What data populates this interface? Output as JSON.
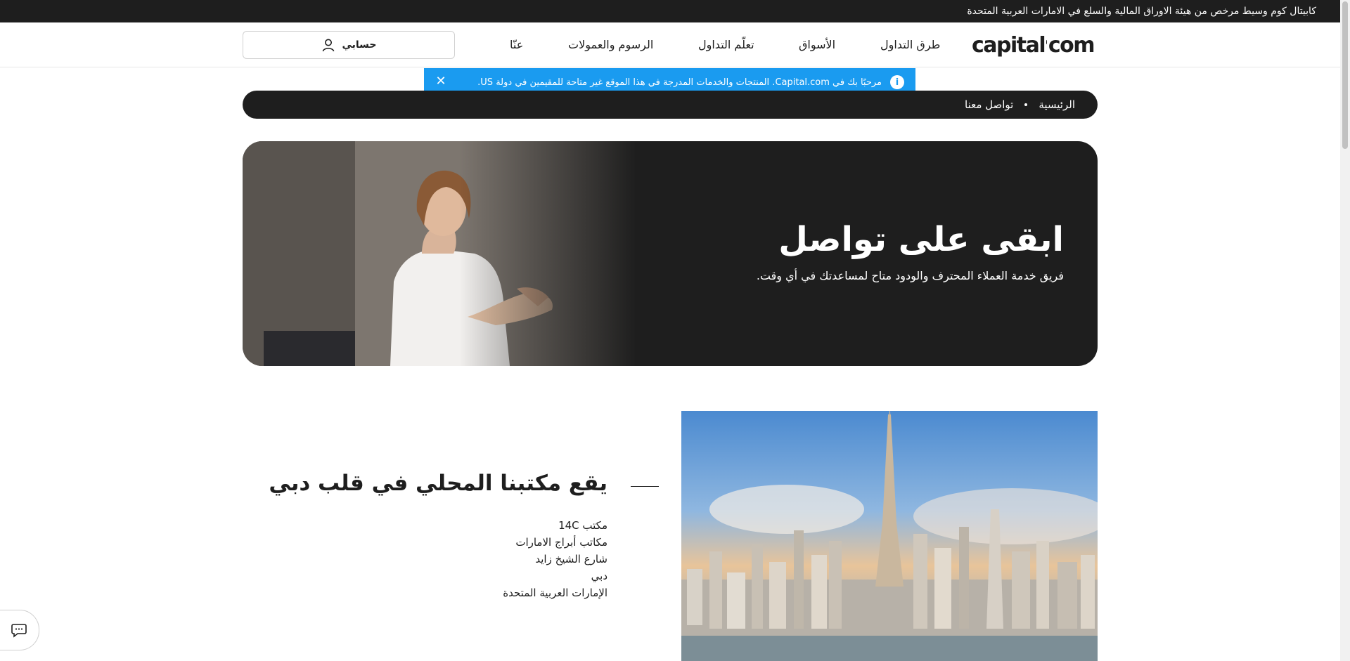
{
  "topbar": {
    "text": "كابيتال كوم وسيط مرخص من هيئة الاوراق المالية والسلع في الامارات العربية المتحدة"
  },
  "header": {
    "logo_left": "capital",
    "logo_right": "com",
    "nav": [
      {
        "label": "طرق التداول"
      },
      {
        "label": "الأسواق"
      },
      {
        "label": "تعلّم التداول"
      },
      {
        "label": "الرسوم والعمولات"
      },
      {
        "label": "عنّا"
      }
    ],
    "account_label": "حسابي"
  },
  "notice": {
    "text": "مرحبًا بك في Capital.com. المنتجات والخدمات المدرجة في هذا الموقع غير متاحة للمقيمين في دولة US.",
    "info_icon": "info-icon",
    "close_glyph": "✕"
  },
  "breadcrumb": {
    "home": "الرئيسية",
    "current": "تواصل معنا"
  },
  "hero": {
    "title": "ابقى على تواصل",
    "subtitle": "فريق خدمة العملاء المحترف والودود متاح لمساعدتك في أي وقت."
  },
  "office": {
    "title": "يقع مكتبنا المحلي في قلب دبي",
    "address_lines": [
      "مكتب 14C",
      "مكاتب أبراج الامارات",
      "شارع الشيخ زايد",
      "دبي",
      "الإمارات العربية المتحدة"
    ]
  },
  "colors": {
    "dark": "#1e1e1e",
    "notice_blue": "#1a9bf0",
    "white": "#ffffff"
  },
  "icons": {
    "account": "user-icon",
    "chat": "chat-bubble-icon"
  }
}
